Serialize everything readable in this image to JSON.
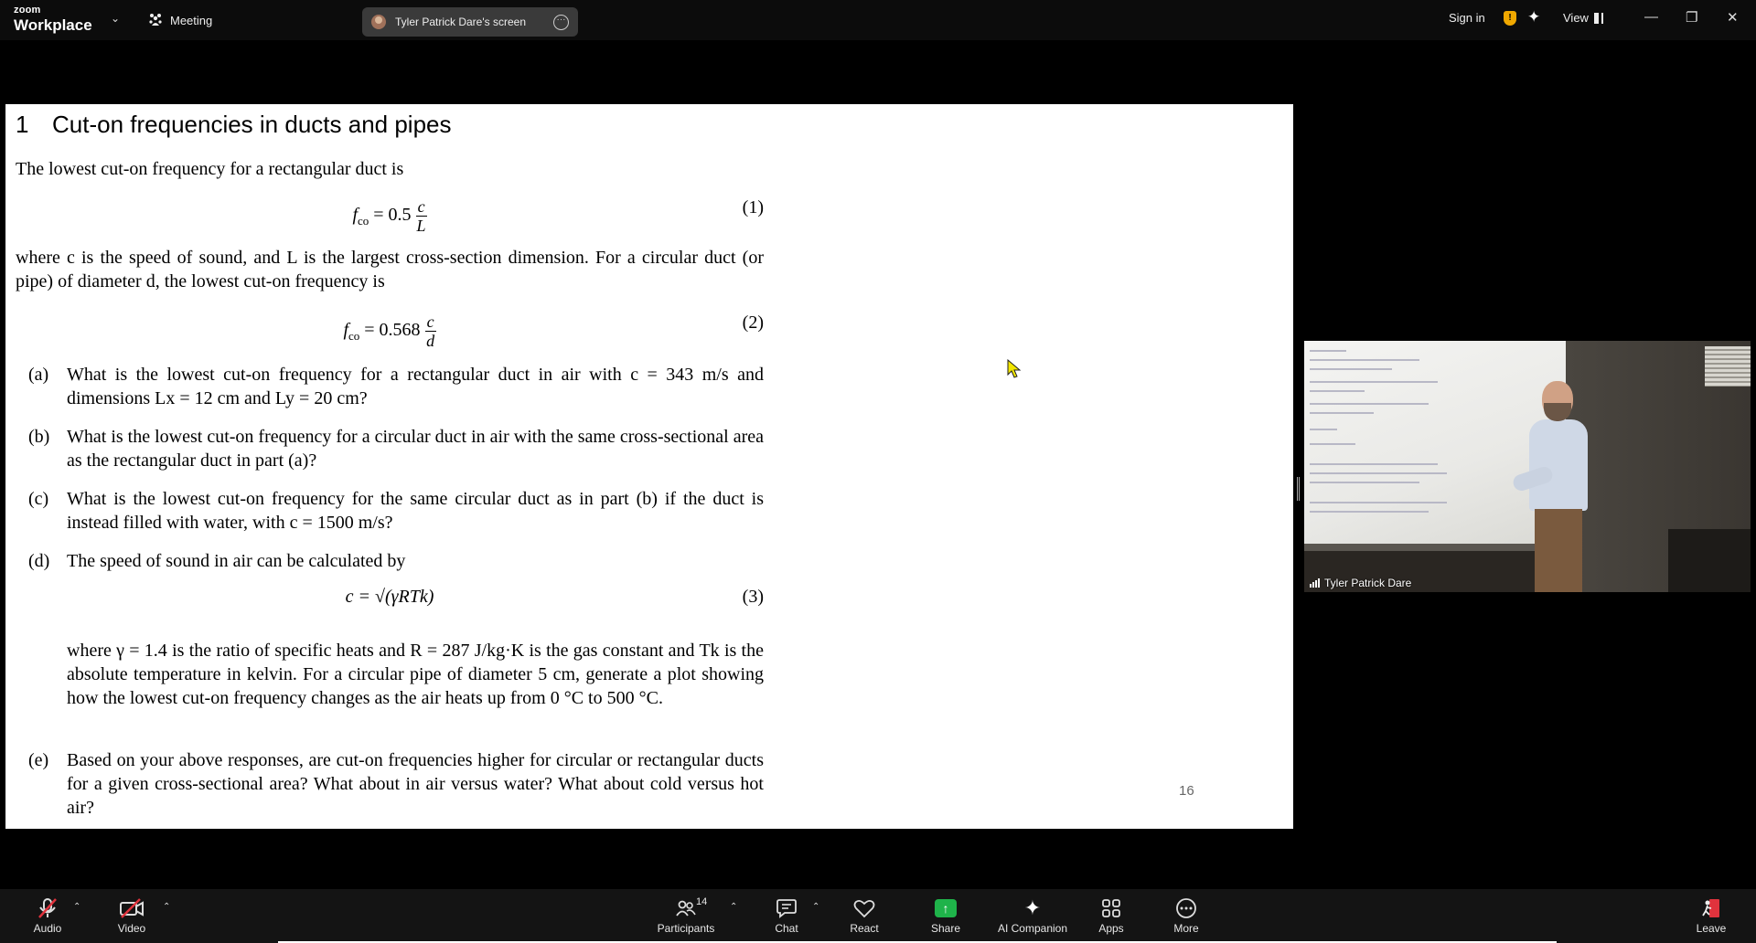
{
  "app": {
    "logo_line1": "zoom",
    "logo_line2": "Workplace",
    "meeting_label": "Meeting",
    "share_pill_label": "Tyler Patrick Dare's screen",
    "sign_in": "Sign in",
    "view_label": "View"
  },
  "document": {
    "section_number": "1",
    "section_title": "Cut-on frequencies in ducts and pipes",
    "intro": "The lowest cut-on frequency for a rectangular duct is",
    "eq1": {
      "lhs": "f",
      "sub": "co",
      "eqcoef": " = 0.5",
      "num": "c",
      "den": "L",
      "tag": "(1)"
    },
    "para2": "where c is the speed of sound, and L is the largest cross-section dimension. For a circular duct (or pipe) of diameter d, the lowest cut-on frequency is",
    "eq2": {
      "lhs": "f",
      "sub": "co",
      "eqcoef": " = 0.568",
      "num": "c",
      "den": "d",
      "tag": "(2)"
    },
    "items": [
      {
        "label": "(a)",
        "text": "What is the lowest cut-on frequency for a rectangular duct in air with c = 343 m/s and dimensions Lx = 12 cm and Ly = 20 cm?"
      },
      {
        "label": "(b)",
        "text": "What is the lowest cut-on frequency for a circular duct in air with the same cross-sectional area as the rectangular duct in part (a)?"
      },
      {
        "label": "(c)",
        "text": "What is the lowest cut-on frequency for the same circular duct as in part (b) if the duct is instead filled with water, with c = 1500 m/s?"
      },
      {
        "label": "(d)",
        "text": "The speed of sound in air can be calculated by"
      },
      {
        "label": "(e)",
        "text": "Based on your above responses, are cut-on frequencies higher for circular or rectangular ducts for a given cross-sectional area? What about in air versus water? What about cold versus hot air?"
      }
    ],
    "eq3": {
      "body": "c = √(γRTk)",
      "tag": "(3)"
    },
    "item_d_cont": "where γ = 1.4 is the ratio of specific heats and R = 287 J/kg·K is the gas constant and Tk is the absolute temperature in kelvin. For a circular pipe of diameter 5 cm, generate a plot showing how the lowest cut-on frequency changes as the air heats up from 0 °C to 500 °C.",
    "page_number": "16"
  },
  "video": {
    "participant_name": "Tyler Patrick Dare"
  },
  "toolbar": {
    "audio": "Audio",
    "video": "Video",
    "participants": "Participants",
    "participants_count": "14",
    "chat": "Chat",
    "react": "React",
    "share": "Share",
    "ai_companion": "AI Companion",
    "apps": "Apps",
    "more": "More",
    "leave": "Leave"
  },
  "colors": {
    "share_green": "#1fb34a",
    "muted_red": "#e0333d",
    "shield_amber": "#f0a800"
  }
}
